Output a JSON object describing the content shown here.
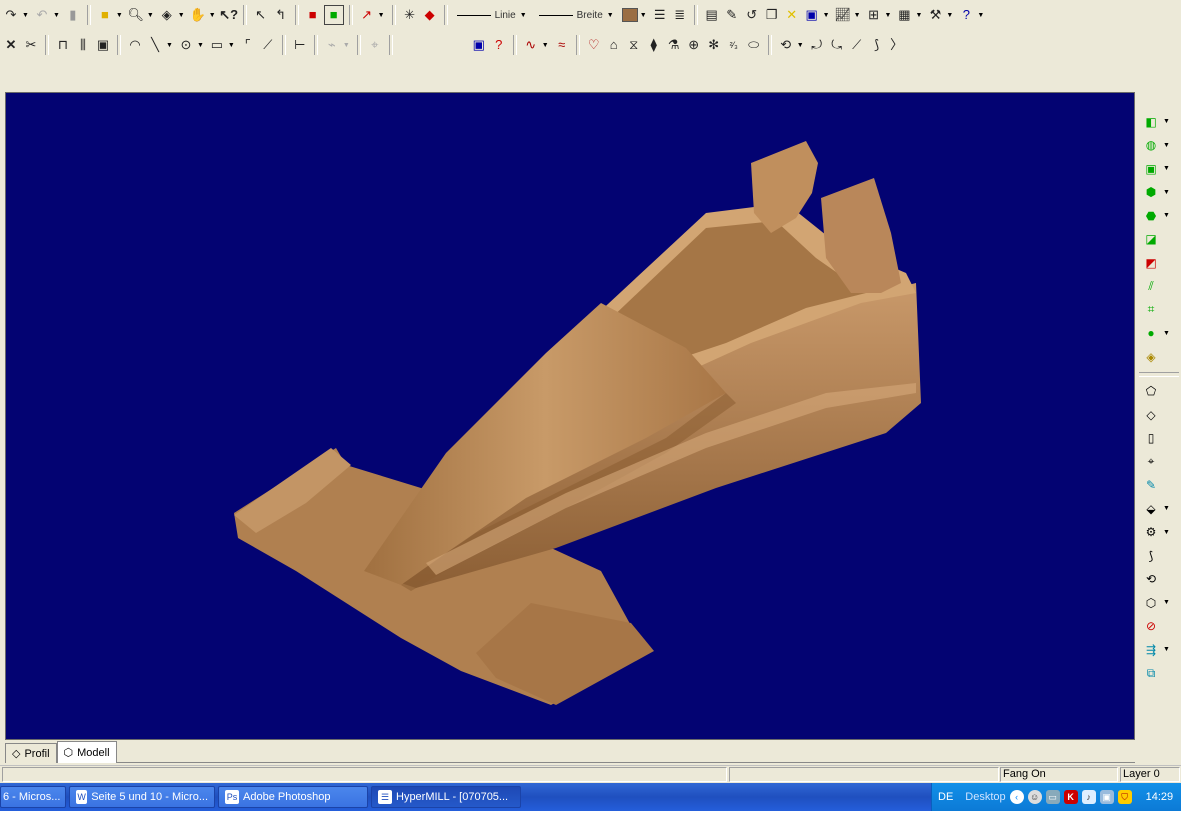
{
  "toolbar1": {
    "line_style_label": "Linie",
    "line_width_label": "Breite",
    "icons": [
      "redo-icon",
      "undo-icon",
      "box-icon",
      "zoom-icon",
      "view-icon",
      "pan-icon",
      "help-icon",
      "select-icon",
      "select-alt-icon",
      "render-icon",
      "shade-icon",
      "pin-icon",
      "sparkle-icon",
      "cube-red-icon",
      "layer-icon",
      "layer2-icon",
      "table-icon",
      "edit-icon",
      "rotate-icon",
      "copy-icon",
      "star-icon",
      "chart-icon",
      "graph-icon",
      "plot-icon",
      "image-icon",
      "wrench-icon",
      "question-icon"
    ],
    "line_color": "#9b6e43"
  },
  "toolbar2": {
    "icons": [
      "delete-icon",
      "trim-icon",
      "extend-icon",
      "mirror-icon",
      "array-icon",
      "arc-icon",
      "line-icon",
      "circle-icon",
      "rectangle-icon",
      "fillet-icon",
      "chamfer-icon",
      "measure-icon",
      "dimension-icon",
      "snap-icon",
      "layer-props-icon",
      "layer-query-icon",
      "spline-icon",
      "spline2-icon",
      "surface-icon",
      "surface2-icon",
      "mesh-icon",
      "blend-icon",
      "flask-icon",
      "sphere-icon",
      "point-icon",
      "fraction-icon",
      "ellipse-icon",
      "curve-icon",
      "curve2-icon",
      "curve3-icon",
      "curve4-icon",
      "curve5-icon",
      "chevron-icon"
    ]
  },
  "viewport": {
    "background": "#030372",
    "model_color": "#b88552"
  },
  "tabs": [
    {
      "label": "Profil",
      "icon": "profile-icon"
    },
    {
      "label": "Modell",
      "icon": "model-icon"
    }
  ],
  "statusbar": {
    "snap": "Fang On",
    "layer": "Layer 0"
  },
  "taskbar": {
    "items": [
      {
        "label": "6 - Micros...",
        "icon": "word-icon"
      },
      {
        "label": "Seite 5 und 10 - Micro...",
        "icon": "word-icon"
      },
      {
        "label": "Adobe Photoshop",
        "icon": "photoshop-icon"
      },
      {
        "label": "HyperMILL - [070705...",
        "icon": "hypermill-icon"
      }
    ],
    "tray": {
      "language": "DE",
      "desktop": "Desktop",
      "time": "14:29"
    }
  }
}
